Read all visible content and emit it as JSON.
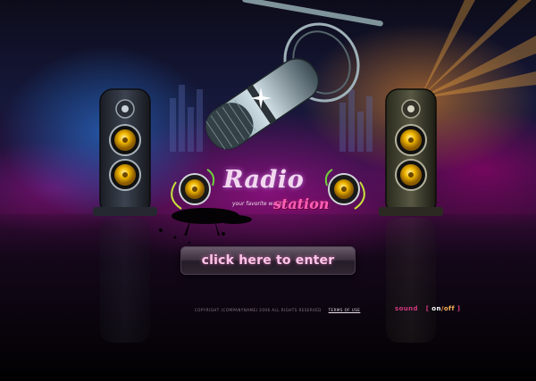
{
  "site": {
    "logo_word": "Radio",
    "logo_subword": "station",
    "tagline": "your favorite wave"
  },
  "enter_button": {
    "label": "click here to enter"
  },
  "footer": {
    "copyright": "COPYRIGHT (COMPANYNAME) 2006 ALL RIGHTS RESERVED",
    "terms_link": "TERMS OF USE"
  },
  "sound": {
    "label": "sound",
    "open_bracket": "[",
    "on": "on",
    "separator": "/",
    "off": "off",
    "close_bracket": "]"
  },
  "colors": {
    "accent_pink": "#ff5fb4",
    "sound_label": "#d2377f",
    "button_text": "#ffc4ea",
    "speaker_cone": "#f2b800"
  }
}
